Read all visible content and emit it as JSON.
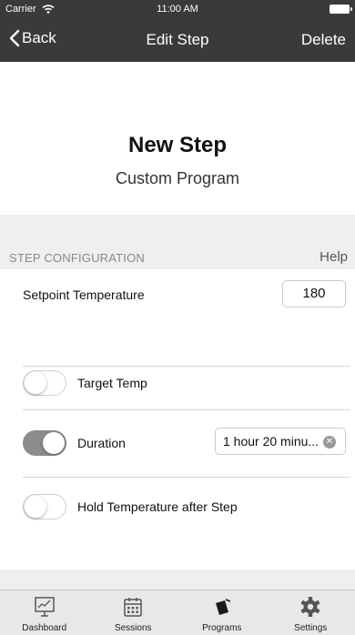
{
  "status_bar": {
    "carrier": "Carrier",
    "time": "11:00 AM"
  },
  "nav": {
    "back_label": "Back",
    "title": "Edit Step",
    "delete_label": "Delete"
  },
  "hero": {
    "title": "New Step",
    "subtitle": "Custom Program"
  },
  "section": {
    "header": "STEP CONFIGURATION",
    "help_label": "Help"
  },
  "rows": {
    "setpoint": {
      "label": "Setpoint Temperature",
      "value": "180"
    },
    "target_temp": {
      "label": "Target Temp",
      "enabled": false
    },
    "duration": {
      "label": "Duration",
      "enabled": true,
      "value": "1 hour 20 minu..."
    },
    "hold": {
      "label": "Hold Temperature after Step",
      "enabled": false
    }
  },
  "tabs": [
    {
      "label": "Dashboard",
      "icon": "dashboard-icon"
    },
    {
      "label": "Sessions",
      "icon": "calendar-icon"
    },
    {
      "label": "Programs",
      "icon": "programs-icon"
    },
    {
      "label": "Settings",
      "icon": "gear-icon"
    }
  ],
  "colors": {
    "bar": "#3a3a3a",
    "toggle_on": "#8c8c8c",
    "background": "#efefef"
  }
}
